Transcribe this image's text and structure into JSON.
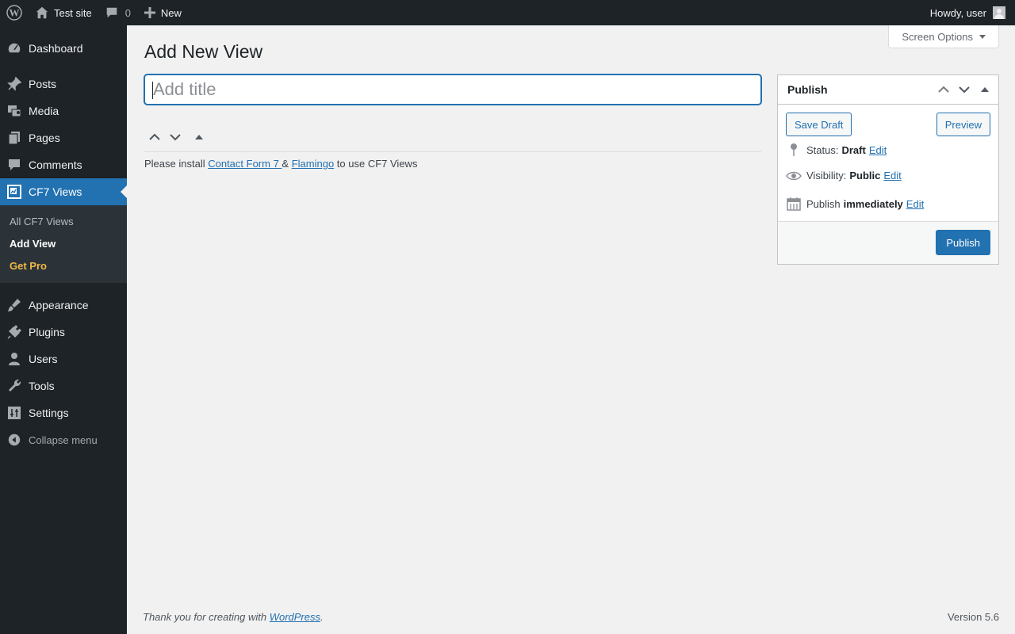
{
  "adminbar": {
    "site_name": "Test site",
    "comments_count": "0",
    "new_label": "New",
    "howdy": "Howdy, user"
  },
  "sidebar": {
    "items": [
      {
        "label": "Dashboard",
        "icon": "dashboard-icon"
      },
      {
        "label": "Posts",
        "icon": "pin-icon"
      },
      {
        "label": "Media",
        "icon": "media-icon"
      },
      {
        "label": "Pages",
        "icon": "pages-icon"
      },
      {
        "label": "Comments",
        "icon": "comment-icon"
      },
      {
        "label": "CF7 Views",
        "icon": "cf7-views-icon"
      },
      {
        "label": "Appearance",
        "icon": "paintbrush-icon"
      },
      {
        "label": "Plugins",
        "icon": "plug-icon"
      },
      {
        "label": "Users",
        "icon": "user-icon"
      },
      {
        "label": "Tools",
        "icon": "wrench-icon"
      },
      {
        "label": "Settings",
        "icon": "settings-icon"
      }
    ],
    "submenu": [
      "All CF7 Views",
      "Add View",
      "Get Pro"
    ],
    "collapse_label": "Collapse menu"
  },
  "header": {
    "screen_options": "Screen Options",
    "title": "Add New View"
  },
  "editor": {
    "title_placeholder": "Add title",
    "install_prefix": "Please install ",
    "link_cf7": "Contact Form 7 ",
    "amp": "& ",
    "link_flamingo": "Flamingo",
    "install_suffix": " to use CF7 Views"
  },
  "publish": {
    "title": "Publish",
    "save_draft": "Save Draft",
    "preview": "Preview",
    "status_label": "Status:",
    "status_value": "Draft",
    "visibility_label": "Visibility:",
    "visibility_value": "Public",
    "publish_label": "Publish",
    "publish_value": "immediately",
    "edit": "Edit",
    "publish_button": "Publish"
  },
  "footer": {
    "thanks_prefix": "Thank you for creating with ",
    "wordpress": "WordPress",
    "period": ".",
    "version": "Version 5.6"
  },
  "colors": {
    "accent": "#2271b1",
    "menu_bg": "#1d2327",
    "get_pro": "#f0b849"
  }
}
